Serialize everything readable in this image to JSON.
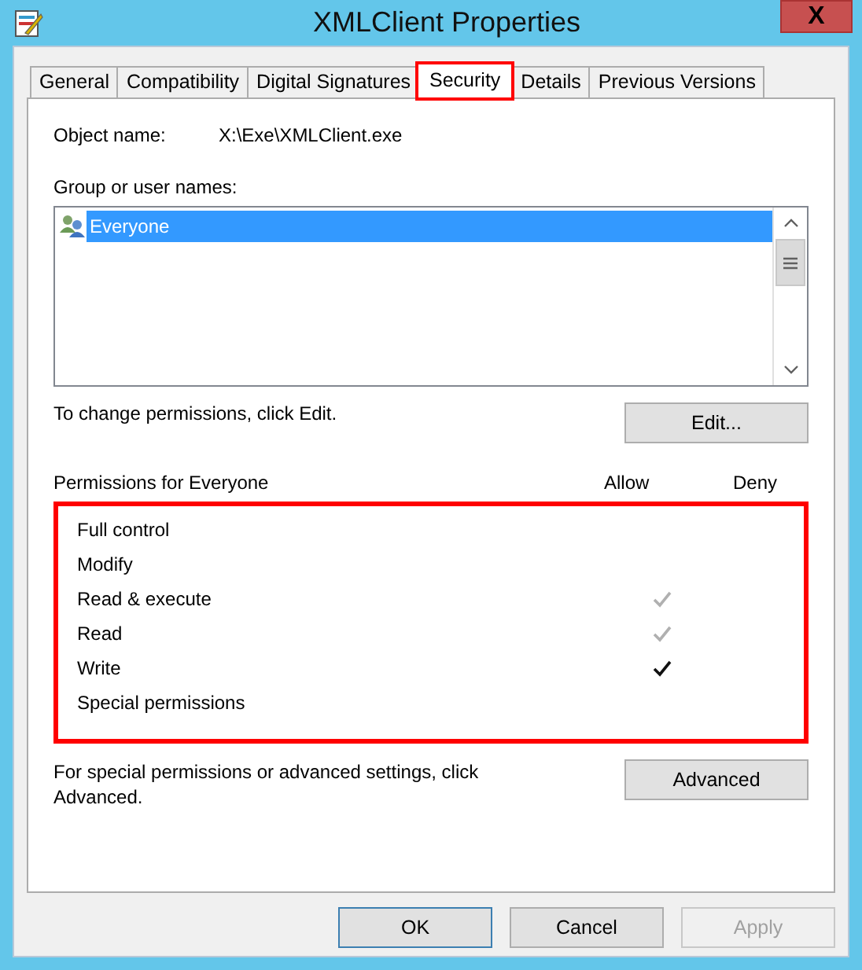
{
  "window": {
    "title": "XMLClient Properties",
    "close": "X"
  },
  "tabs": [
    {
      "label": "General",
      "selected": false,
      "highlighted": false
    },
    {
      "label": "Compatibility",
      "selected": false,
      "highlighted": false
    },
    {
      "label": "Digital Signatures",
      "selected": false,
      "highlighted": false
    },
    {
      "label": "Security",
      "selected": true,
      "highlighted": true
    },
    {
      "label": "Details",
      "selected": false,
      "highlighted": false
    },
    {
      "label": "Previous Versions",
      "selected": false,
      "highlighted": false
    }
  ],
  "object_name": {
    "label": "Object name:",
    "value": "X:\\Exe\\XMLClient.exe"
  },
  "group_list": {
    "label": "Group or user names:",
    "items": [
      {
        "name": "Everyone",
        "selected": true
      }
    ]
  },
  "edit_hint": "To change permissions, click Edit.",
  "edit_button": "Edit...",
  "permissions": {
    "label": "Permissions for Everyone",
    "allow_header": "Allow",
    "deny_header": "Deny",
    "highlighted": true,
    "rows": [
      {
        "name": "Full control",
        "allowed": false
      },
      {
        "name": "Modify",
        "allowed": false
      },
      {
        "name": "Read & execute",
        "allowed": true,
        "inherited": true
      },
      {
        "name": "Read",
        "allowed": true,
        "inherited": true
      },
      {
        "name": "Write",
        "allowed": true,
        "inherited": false
      },
      {
        "name": "Special permissions",
        "allowed": false
      }
    ]
  },
  "advanced_hint": "For special permissions or advanced settings, click Advanced.",
  "advanced_button": "Advanced",
  "buttons": [
    {
      "label": "OK",
      "default": true,
      "disabled": false
    },
    {
      "label": "Cancel",
      "default": false,
      "disabled": false
    },
    {
      "label": "Apply",
      "default": false,
      "disabled": true
    }
  ]
}
